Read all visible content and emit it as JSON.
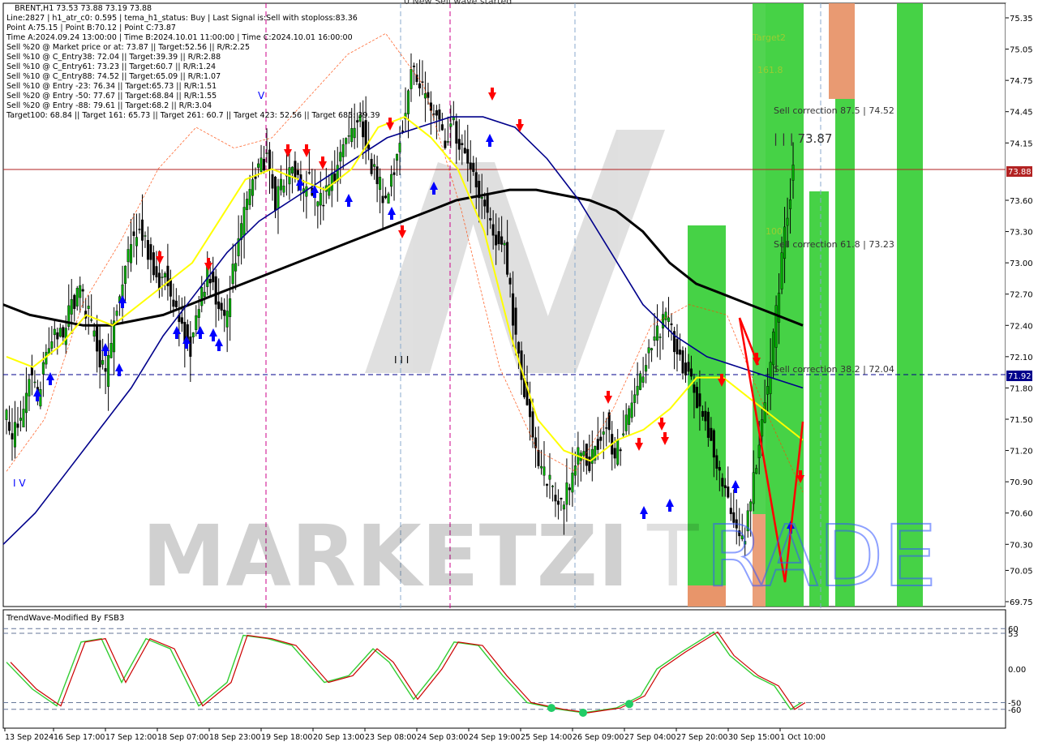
{
  "header": {
    "partial_title": "0 New Sell wave started",
    "info_lines": [
      "BRENT,H1  73.53 73.88 73.19 73.88",
      "Line:2827  |  h1_atr_c0: 0.595  |  tema_h1_status: Buy  |  Last Signal is:Sell with stoploss:83.36",
      "Point A:75.15  |  Point B:70.12  |  Point C:73.87",
      "Time A:2024.09.24 13:00:00  |  Time B:2024.10.01 11:00:00  |  Time C:2024.10.01 16:00:00",
      "Sell %20 @ Market price or at: 73.87  ||  Target:52.56  ||  R/R:2.25",
      "Sell %10 @ C_Entry38: 72.04  ||  Target:39.39  ||  R/R:2.88",
      "Sell %10 @ C_Entry61: 73.23  ||  Target:60.7  ||  R/R:1.24",
      "Sell %10 @ C_Entry88: 74.52  ||  Target:65.09  ||  R/R:1.07",
      "Sell %10 @ Entry -23: 76.34  ||  Target:65.73  ||  R/R:1.51",
      "Sell %20 @ Entry -50: 77.67  ||  Target:68.84  ||  R/R:1.55",
      "Sell %20 @ Entry -88: 79.61  ||  Target:68.2  ||  R/R:3.04",
      "Target100: 68.84  ||  Target 161: 65.73  ||  Target 261: 60.7  ||  Target 423: 52.56  ||  Target 685: 39.39"
    ]
  },
  "annotations": {
    "target2": "Target2",
    "t1618": "161.8",
    "t100": "100",
    "sell_875": "Sell correction 87.5 | 74.52",
    "price_c": "| | | 73.87",
    "sell_618": "Sell correction 61.8 | 73.23",
    "sell_382": "Sell correction 38.2 | 72.04",
    "wave_v": "V",
    "wave_iv": "I V",
    "wave_iii": "I I I"
  },
  "price_axis": {
    "ticks": [
      "75.35",
      "75.05",
      "74.75",
      "74.45",
      "74.15",
      "73.88",
      "73.60",
      "73.30",
      "73.00",
      "72.70",
      "72.40",
      "72.10",
      "71.92",
      "71.80",
      "71.50",
      "71.20",
      "70.90",
      "70.60",
      "70.30",
      "70.05",
      "69.75"
    ],
    "current_price": "73.88",
    "level_price": "71.92"
  },
  "indicator": {
    "name": "TrendWave-Modified By FSB3",
    "ticks": [
      "60",
      "53",
      "0.00",
      "-50",
      "-60"
    ]
  },
  "time_axis": [
    "13 Sep 2024",
    "16 Sep 17:00",
    "17 Sep 12:00",
    "18 Sep 07:00",
    "18 Sep 23:00",
    "19 Sep 18:00",
    "20 Sep 13:00",
    "23 Sep 08:00",
    "24 Sep 03:00",
    "24 Sep 19:00",
    "25 Sep 14:00",
    "26 Sep 09:00",
    "27 Sep 04:00",
    "27 Sep 20:00",
    "30 Sep 15:00",
    "1 Oct 10:00"
  ],
  "watermark": {
    "dark": "MARKETZI",
    "grey": "T",
    "colored": "RADE"
  },
  "colors": {
    "up_candle": "#000000",
    "sell_arrow": "#ff0000",
    "buy_arrow": "#0000ff",
    "ma_black": "#000000",
    "ma_navy": "#00008b",
    "tema_yellow": "#ffff00",
    "zone_green": "#32cd32",
    "zone_orange": "#e8956a",
    "price_line": "#b22222",
    "level_line": "#00008b"
  },
  "chart_data": {
    "type": "candlestick",
    "symbol": "BRENT",
    "timeframe": "H1",
    "ylim": [
      69.65,
      75.45
    ],
    "closes": [
      71.6,
      71.3,
      71.5,
      71.9,
      71.7,
      72.2,
      72.4,
      72.3,
      72.6,
      72.7,
      72.5,
      72.2,
      71.9,
      72.4,
      72.8,
      73.2,
      73.4,
      73.1,
      72.8,
      72.9,
      72.6,
      72.4,
      72.2,
      72.6,
      72.9,
      72.7,
      72.4,
      72.9,
      73.3,
      73.7,
      73.9,
      74.0,
      73.6,
      73.8,
      73.9,
      73.7,
      73.8,
      73.5,
      73.7,
      73.8,
      74.1,
      74.2,
      74.4,
      74.0,
      73.8,
      73.6,
      73.9,
      74.3,
      74.9,
      74.7,
      74.5,
      74.4,
      74.2,
      74.3,
      74.1,
      73.9,
      73.7,
      73.5,
      73.2,
      73.1,
      72.5,
      71.9,
      71.5,
      71.1,
      70.9,
      70.8,
      70.7,
      71.0,
      71.2,
      71.1,
      71.3,
      71.5,
      71.1,
      71.4,
      71.7,
      71.9,
      72.1,
      72.3,
      72.5,
      72.2,
      72.0,
      71.9,
      71.6,
      71.4,
      71.1,
      70.8,
      70.5,
      70.3,
      70.7,
      71.3,
      71.8,
      72.5,
      73.3,
      73.88
    ],
    "ma_black": [
      72.6,
      72.5,
      72.45,
      72.4,
      72.4,
      72.45,
      72.5,
      72.6,
      72.7,
      72.8,
      72.9,
      73.0,
      73.1,
      73.2,
      73.3,
      73.4,
      73.5,
      73.6,
      73.65,
      73.7,
      73.7,
      73.65,
      73.6,
      73.5,
      73.3,
      73.0,
      72.8,
      72.7,
      72.6,
      72.5,
      72.4
    ],
    "ma_navy": [
      70.3,
      70.6,
      71.0,
      71.4,
      71.8,
      72.3,
      72.7,
      73.1,
      73.4,
      73.6,
      73.8,
      74.0,
      74.2,
      74.3,
      74.4,
      74.4,
      74.3,
      74.0,
      73.6,
      73.1,
      72.6,
      72.3,
      72.1,
      72.0,
      71.9,
      71.8
    ],
    "tema_yellow": [
      72.1,
      72.0,
      72.2,
      72.5,
      72.4,
      72.6,
      72.8,
      73.0,
      73.4,
      73.8,
      73.9,
      73.8,
      73.7,
      73.9,
      74.3,
      74.4,
      74.2,
      73.9,
      73.3,
      72.3,
      71.5,
      71.2,
      71.1,
      71.3,
      71.4,
      71.6,
      71.9,
      71.9,
      71.7,
      71.5,
      71.3
    ]
  }
}
